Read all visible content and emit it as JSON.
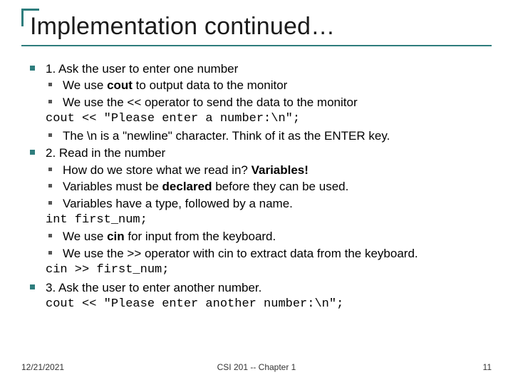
{
  "title": "Implementation continued…",
  "items": {
    "i1": "1. Ask the user to enter one number",
    "i1a_pre": "We use ",
    "i1a_b": "cout",
    "i1a_post": " to output data to the monitor",
    "i1b": "We use the << operator to send the data to the monitor",
    "code1": "cout << \"Please enter a number:\\n\";",
    "i1c": "The \\n is a \"newline\" character. Think of it as the ENTER key.",
    "i2": "2. Read in the number",
    "i2a_pre": "How do we store what we read in? ",
    "i2a_b": "Variables!",
    "i2b_pre": "Variables must be ",
    "i2b_b": "declared",
    "i2b_post": " before they can be used.",
    "i2c": "Variables have a type, followed by a name.",
    "code2": "int first_num;",
    "i2d_pre": "We use ",
    "i2d_b": "cin",
    "i2d_post": " for input from the keyboard.",
    "i2e": "We use the >> operator with cin to extract data from the keyboard.",
    "code3": "cin >> first_num;",
    "i3": "3. Ask the user to enter another number.",
    "code4": "cout << \"Please enter another number:\\n\";"
  },
  "footer": {
    "date": "12/21/2021",
    "center": "CSI 201 -- Chapter 1",
    "page": "11"
  }
}
